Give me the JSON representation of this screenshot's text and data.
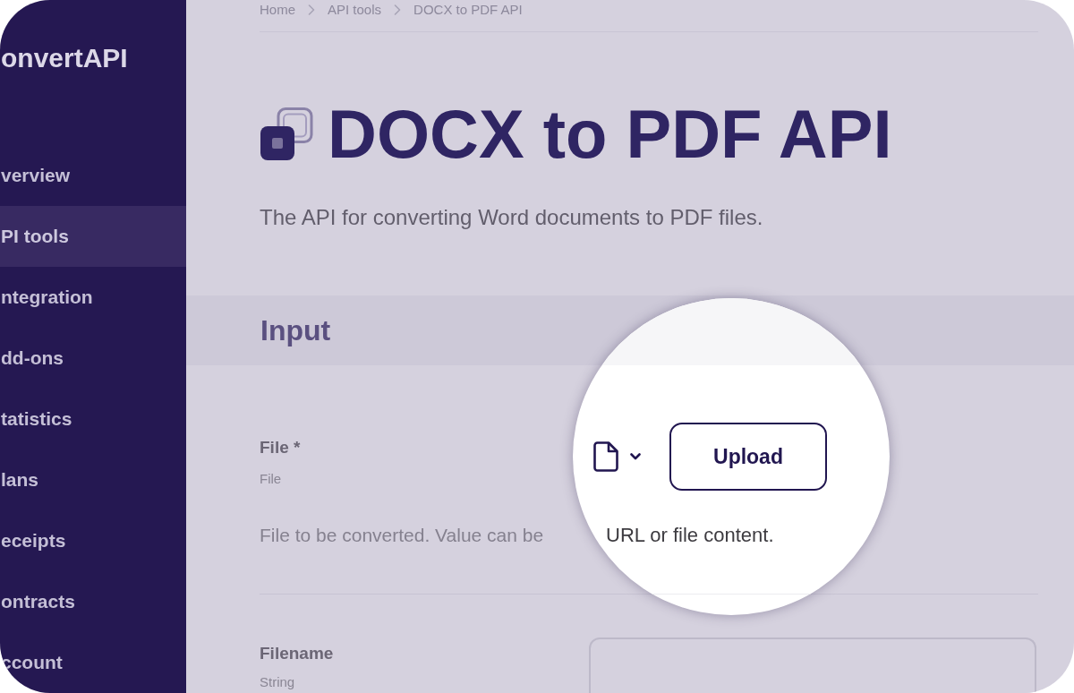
{
  "sidebar": {
    "brand": "onvertAPI",
    "items": [
      {
        "label": "verview",
        "selected": false
      },
      {
        "label": "PI tools",
        "selected": true
      },
      {
        "label": "ntegration",
        "selected": false
      },
      {
        "label": "dd-ons",
        "selected": false
      },
      {
        "label": "tatistics",
        "selected": false
      },
      {
        "label": "lans",
        "selected": false
      },
      {
        "label": "eceipts",
        "selected": false
      },
      {
        "label": "ontracts",
        "selected": false
      },
      {
        "label": "ccount",
        "selected": false
      }
    ]
  },
  "breadcrumb": [
    "Home",
    "API tools",
    "DOCX to PDF API"
  ],
  "page": {
    "title": "DOCX to PDF API",
    "subtitle": "The API for converting Word documents to PDF files."
  },
  "section": {
    "title": "Input"
  },
  "fields": [
    {
      "kind": "file",
      "label": "File *",
      "type": "File",
      "description": "File to be converted. Value can be"
    },
    {
      "kind": "text",
      "label": "Filename",
      "type": "String"
    }
  ],
  "magnifier": {
    "upload_button": "Upload",
    "description": "URL or file content."
  }
}
